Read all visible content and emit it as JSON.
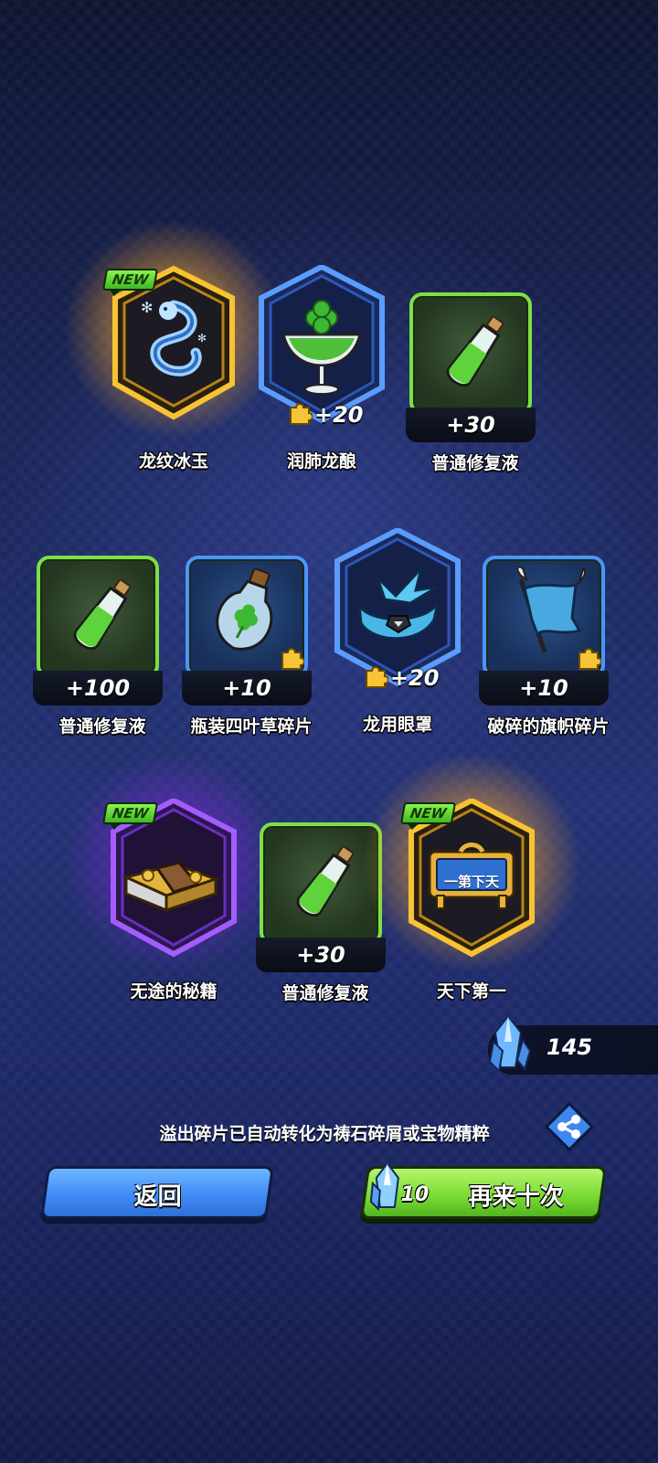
{
  "items": [
    {
      "name": "龙纹冰玉",
      "count": "",
      "is_new": true,
      "frame": "gold-hex",
      "icon": "ice-dragon-jade-icon"
    },
    {
      "name": "润肺龙酿",
      "count": "+20",
      "is_new": false,
      "frame": "blue-hex",
      "icon": "clover-cocktail-icon",
      "fragment": true
    },
    {
      "name": "普通修复液",
      "count": "+30",
      "is_new": false,
      "frame": "green-square",
      "icon": "green-potion-icon"
    },
    {
      "name": "普通修复液",
      "count": "+100",
      "is_new": false,
      "frame": "green-square",
      "icon": "green-potion-icon"
    },
    {
      "name": "瓶装四叶草碎片",
      "count": "+10",
      "is_new": false,
      "frame": "blue-square",
      "icon": "bottled-clover-icon",
      "fragment": true
    },
    {
      "name": "龙用眼罩",
      "count": "+20",
      "is_new": false,
      "frame": "blue-hex",
      "icon": "dragon-eyepatch-icon",
      "fragment": true
    },
    {
      "name": "破碎的旗帜碎片",
      "count": "+10",
      "is_new": false,
      "frame": "blue-square",
      "icon": "broken-banner-icon",
      "fragment": true
    },
    {
      "name": "无途的秘籍",
      "count": "",
      "is_new": true,
      "frame": "purple-hex",
      "icon": "secret-book-icon"
    },
    {
      "name": "普通修复液",
      "count": "+30",
      "is_new": false,
      "frame": "green-square",
      "icon": "green-potion-icon"
    },
    {
      "name": "天下第一",
      "count": "",
      "is_new": true,
      "frame": "gold-hex",
      "icon": "plaque-icon",
      "plaque_text": "一第下天"
    }
  ],
  "new_label": "NEW",
  "currency": {
    "icon": "blue-crystal-icon",
    "value": "145"
  },
  "notice": "溢出碎片已自动转化为祷石碎屑或宝物精粹",
  "buttons": {
    "back": "返回",
    "again": "再来十次",
    "again_cost": "10"
  },
  "colors": {
    "gold": "#f4b826",
    "blue": "#4a8cf0",
    "green": "#7ee043",
    "purple": "#8a3fe0"
  }
}
